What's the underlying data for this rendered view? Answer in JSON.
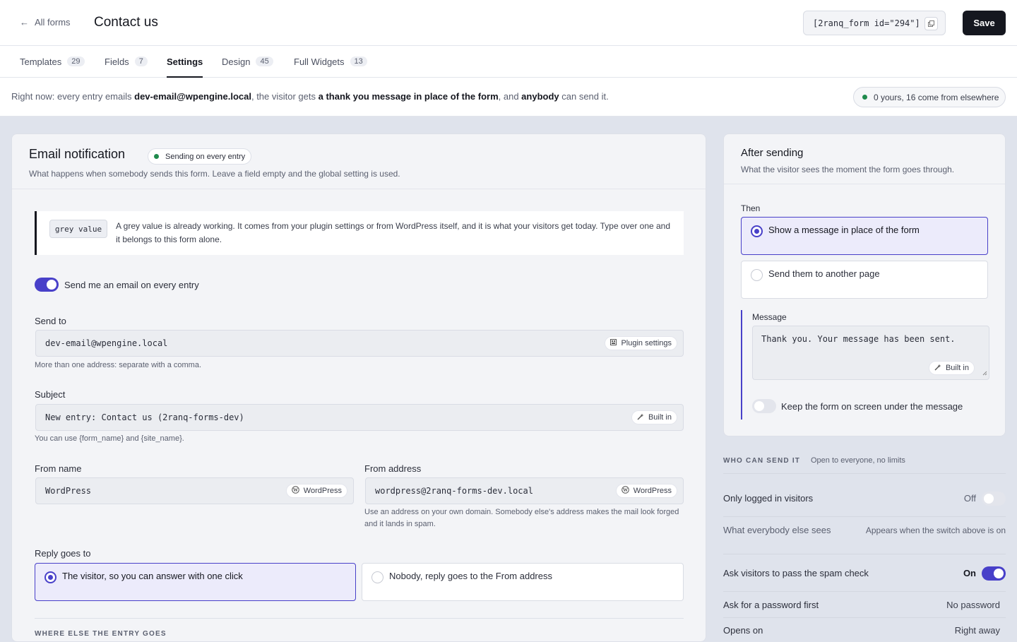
{
  "header": {
    "back_label": "All forms",
    "back_arrow": "←",
    "title": "Contact us",
    "shortcode": "[2ranq_form id=\"294\"]",
    "save_label": "Save"
  },
  "tabs": [
    {
      "label": "Templates",
      "count": "29"
    },
    {
      "label": "Fields",
      "count": "7"
    },
    {
      "label": "Settings",
      "count": ""
    },
    {
      "label": "Design",
      "count": "45"
    },
    {
      "label": "Full Widgets",
      "count": "13"
    }
  ],
  "summary": {
    "p1": "Right now: every entry emails ",
    "email": "dev-email@wpengine.local",
    "p2": ", the visitor gets ",
    "thanks": "a thank you message in place of the form",
    "p3": ", and ",
    "who": "anybody",
    "p4": " can send it.",
    "pill": "0 yours, 16 come from elsewhere"
  },
  "email_card": {
    "title": "Email notification",
    "status": "Sending on every entry",
    "subtitle": "What happens when somebody sends this form. Leave a field empty and the global setting is used.",
    "notice_chip": "grey value",
    "notice_text": "A grey value is already working. It comes from your plugin settings or from WordPress itself, and it is what your visitors get today. Type over one and it belongs to this form alone.",
    "toggle_label": "Send me an email on every entry",
    "send_to": {
      "label": "Send to",
      "value": "dev-email@wpengine.local",
      "source": "Plugin settings",
      "hint": "More than one address: separate with a comma."
    },
    "subject": {
      "label": "Subject",
      "value": "New entry: Contact us (2ranq-forms-dev)",
      "source": "Built in",
      "hint": "You can use {form_name} and {site_name}."
    },
    "from_name": {
      "label": "From name",
      "value": "WordPress",
      "source": "WordPress"
    },
    "from_address": {
      "label": "From address",
      "value": "wordpress@2ranq-forms-dev.local",
      "source": "WordPress",
      "hint": "Use an address on your own domain. Somebody else's address makes the mail look forged and it lands in spam."
    },
    "reply": {
      "label": "Reply goes to",
      "option_a": "The visitor, so you can answer with one click",
      "option_b": "Nobody, reply goes to the From address"
    },
    "next_section": "WHERE ELSE THE ENTRY GOES"
  },
  "after_card": {
    "title": "After sending",
    "subtitle": "What the visitor sees the moment the form goes through.",
    "then_label": "Then",
    "option_a": "Show a message in place of the form",
    "option_b": "Send them to another page",
    "message_label": "Message",
    "message_value": "Thank you. Your message has been sent.",
    "message_source": "Built in",
    "keep_label": "Keep the form on screen under the message"
  },
  "who": {
    "title": "WHO CAN SEND IT",
    "subtitle": "Open to everyone, no limits",
    "logged_in_label": "Only logged in visitors",
    "logged_in_state": "Off",
    "else_label": "What everybody else sees",
    "else_value": "Appears when the switch above is on",
    "spam_label": "Ask visitors to pass the spam check",
    "spam_state": "On",
    "password_label": "Ask for a password first",
    "password_value": "No password",
    "opens_label": "Opens on",
    "opens_value": "Right away"
  },
  "colors": {
    "accent": "#4840c9",
    "status_green": "#1f8a4c",
    "dark": "#15171f"
  }
}
